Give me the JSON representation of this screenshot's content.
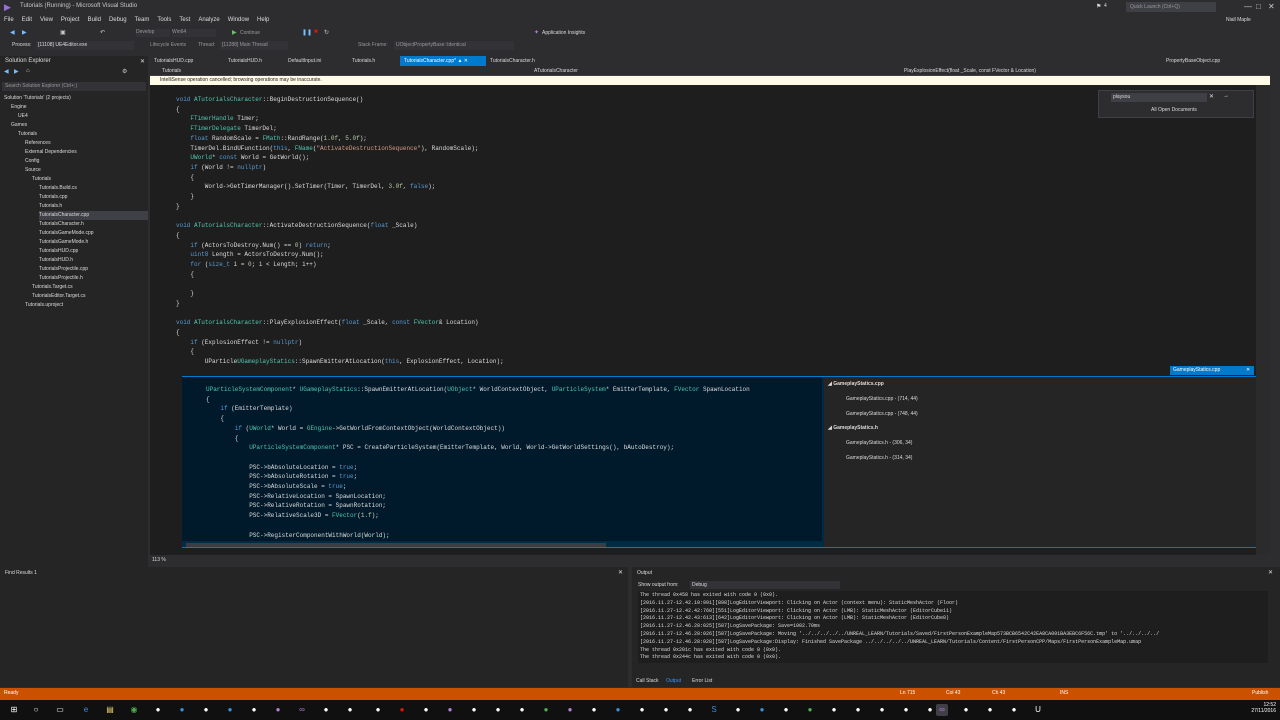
{
  "window": {
    "title": "Tutorials (Running) - Microsoft Visual Studio",
    "quick_launch": "Quick Launch (Ctrl+Q)",
    "user": "Niall Maple",
    "notif_count": "4"
  },
  "menu": [
    "File",
    "Edit",
    "View",
    "Project",
    "Build",
    "Debug",
    "Team",
    "Tools",
    "Test",
    "Analyze",
    "Window",
    "Help"
  ],
  "toolbar": {
    "config": "Develop",
    "platform": "Win64",
    "continue": "Continue",
    "insights": "Application Insights"
  },
  "processbar": {
    "process_label": "Process:",
    "process": "[11108] UE4Editor.exe",
    "lifecycle": "Lifecycle Events",
    "thread_label": "Thread:",
    "thread": "[11288] Main Thread",
    "stack_label": "Stack Frame:",
    "stack": "UObjectPropertyBase::Identical"
  },
  "solution_explorer": {
    "title": "Solution Explorer",
    "search_placeholder": "Search Solution Explorer (Ctrl+;)",
    "items": [
      {
        "label": "Solution 'Tutorials' (2 projects)",
        "indent": 0
      },
      {
        "label": "Engine",
        "indent": 1
      },
      {
        "label": "UE4",
        "indent": 2
      },
      {
        "label": "Games",
        "indent": 1
      },
      {
        "label": "Tutorials",
        "indent": 2
      },
      {
        "label": "References",
        "indent": 3
      },
      {
        "label": "External Dependencies",
        "indent": 3
      },
      {
        "label": "Config",
        "indent": 3
      },
      {
        "label": "Source",
        "indent": 3
      },
      {
        "label": "Tutorials",
        "indent": 4
      },
      {
        "label": "Tutorials.Build.cs",
        "indent": 5
      },
      {
        "label": "Tutorials.cpp",
        "indent": 5
      },
      {
        "label": "Tutorials.h",
        "indent": 5
      },
      {
        "label": "TutorialsCharacter.cpp",
        "indent": 5,
        "selected": true
      },
      {
        "label": "TutorialsCharacter.h",
        "indent": 5
      },
      {
        "label": "TutorialsGameMode.cpp",
        "indent": 5
      },
      {
        "label": "TutorialsGameMode.h",
        "indent": 5
      },
      {
        "label": "TutorialsHUD.cpp",
        "indent": 5
      },
      {
        "label": "TutorialsHUD.h",
        "indent": 5
      },
      {
        "label": "TutorialsProjectile.cpp",
        "indent": 5
      },
      {
        "label": "TutorialsProjectile.h",
        "indent": 5
      },
      {
        "label": "Tutorials.Target.cs",
        "indent": 4
      },
      {
        "label": "TutorialsEditor.Target.cs",
        "indent": 4
      },
      {
        "label": "Tutorials.uproject",
        "indent": 3
      }
    ]
  },
  "tabs": [
    {
      "label": "TutorialsHUD.cpp"
    },
    {
      "label": "TutorialsHUD.h"
    },
    {
      "label": "DefaultInput.ini"
    },
    {
      "label": "Tutorials.h"
    },
    {
      "label": "TutorialsCharacter.cpp*",
      "active": true
    },
    {
      "label": "TutorialsCharacter.h"
    },
    {
      "label": "PropertyBaseObject.cpp"
    }
  ],
  "navbar": {
    "project": "Tutorials",
    "class": "ATutorialsCharacter",
    "member": "PlayExplosionEffect(float _Scale, const FVector & Location)"
  },
  "infobar": "IntelliSense operation cancelled; browsing operations may be inaccurate.",
  "findbox": {
    "query": "playsou",
    "scope": "All Open Documents"
  },
  "zoom": "113 %",
  "peek": {
    "title": "GameplayStatics.cpp",
    "groups": [
      {
        "file": "GameplayStatics.cpp",
        "items": [
          "GameplayStatics.cpp - (714, 44)",
          "GameplayStatics.cpp - (748, 44)"
        ]
      },
      {
        "file": "GameplayStatics.h",
        "items": [
          "GameplayStatics.h - (306, 34)",
          "GameplayStatics.h - (314, 34)"
        ]
      }
    ]
  },
  "find_results": {
    "title": "Find Results 1"
  },
  "output": {
    "title": "Output",
    "source_label": "Show output from:",
    "source": "Debug",
    "lines": [
      "The thread 0x458 has exited with code 0 (0x0).",
      "[2016.11.27-12.42.10:991][898]LogEditorViewport: Clicking on Actor (context menu): StaticMeshActor (Floor)",
      "[2016.11.27-12.42.42:760][551]LogEditorViewport: Clicking on Actor (LMB): StaticMeshActor (EditorCube11)",
      "[2016.11.27-12.42.43:613][642]LogEditorViewport: Clicking on Actor (LMB): StaticMeshActor (EditorCube8)",
      "[2016.11.27-12.46.28:025][587]LogSavePackage: Save=1002.70ms",
      "[2016.11.27-12.46.28:026][587]LogSavePackage: Moving '../../../../../UNREAL_LEARN/Tutorials/Saved/FirstPersonExampleMap573BCB6542C42EA8CA091BA3EBC6F56C.tmp' to '../../../../",
      "[2016.11.27-12.46.28:028][587]LogSavePackage:Display: Finished SavePackage ../../../../../UNREAL_LEARN/Tutorials/Content/FirstPersonCPP/Maps/FirstPersonExampleMap.umap",
      "The thread 0x201c has exited with code 0 (0x0).",
      "The thread 0x244c has exited with code 0 (0x0)."
    ]
  },
  "bottom_tabs": [
    "Call Stack",
    "Output",
    "Error List"
  ],
  "status": {
    "ready": "Ready",
    "ln": "Ln 715",
    "col": "Col 43",
    "ch": "Ch 43",
    "ins": "INS",
    "publish": "Publish"
  },
  "clock": {
    "time": "12:52",
    "date": "27/11/2016"
  }
}
